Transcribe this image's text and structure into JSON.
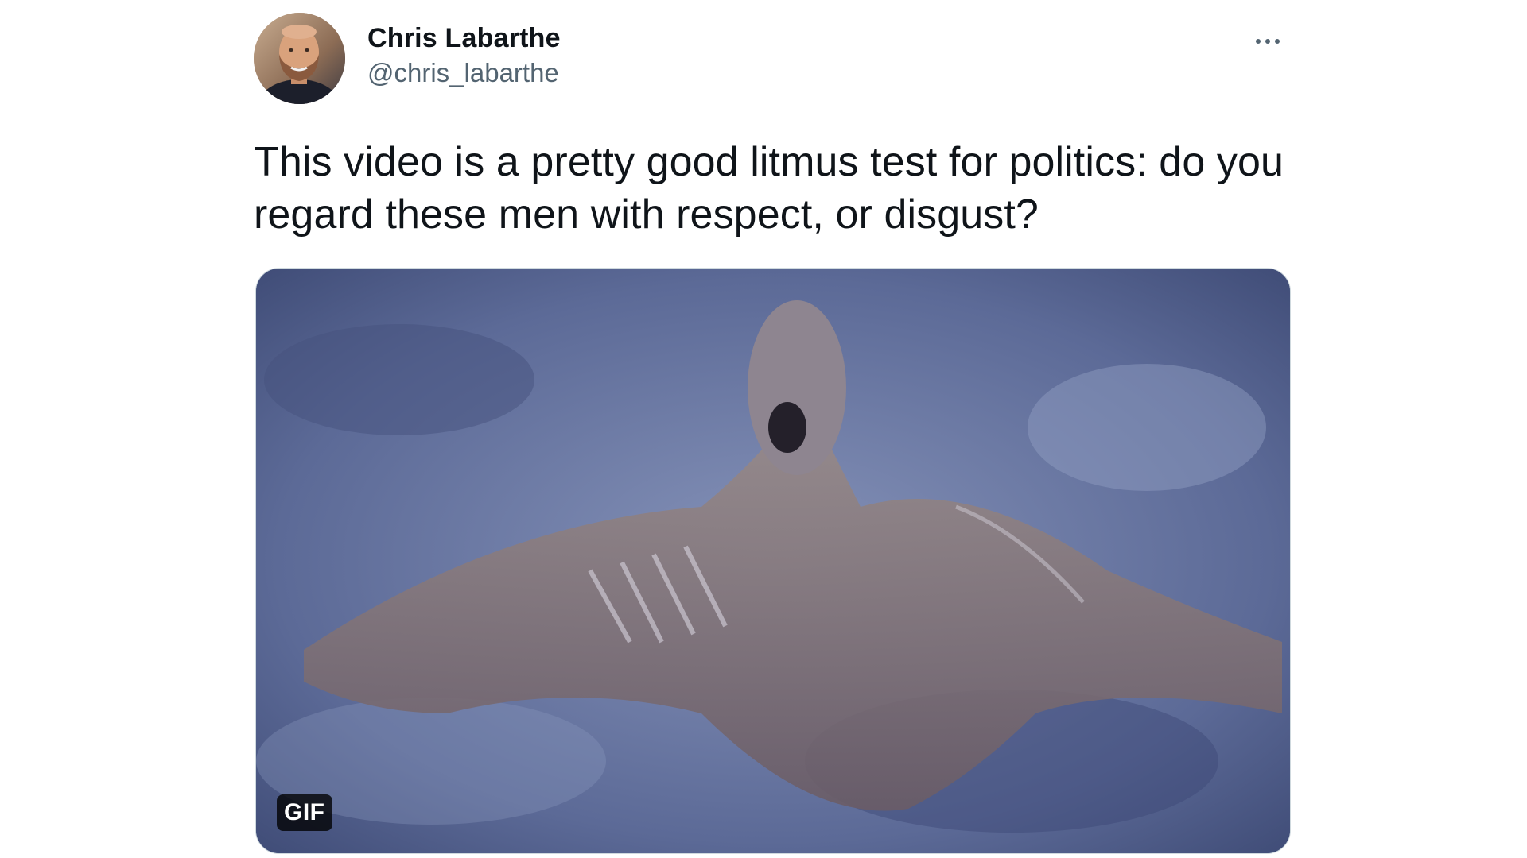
{
  "author": {
    "display_name": "Chris Labarthe",
    "handle": "@chris_labarthe"
  },
  "tweet": {
    "text": "This video is a pretty good litmus test for politics: do you regard these men with respect, or disgust?"
  },
  "media": {
    "badge": "GIF"
  },
  "icons": {
    "more": "more-horizontal-icon"
  },
  "colors": {
    "text_primary": "#0f1419",
    "text_secondary": "#536471",
    "media_border": "#cfd9de"
  }
}
